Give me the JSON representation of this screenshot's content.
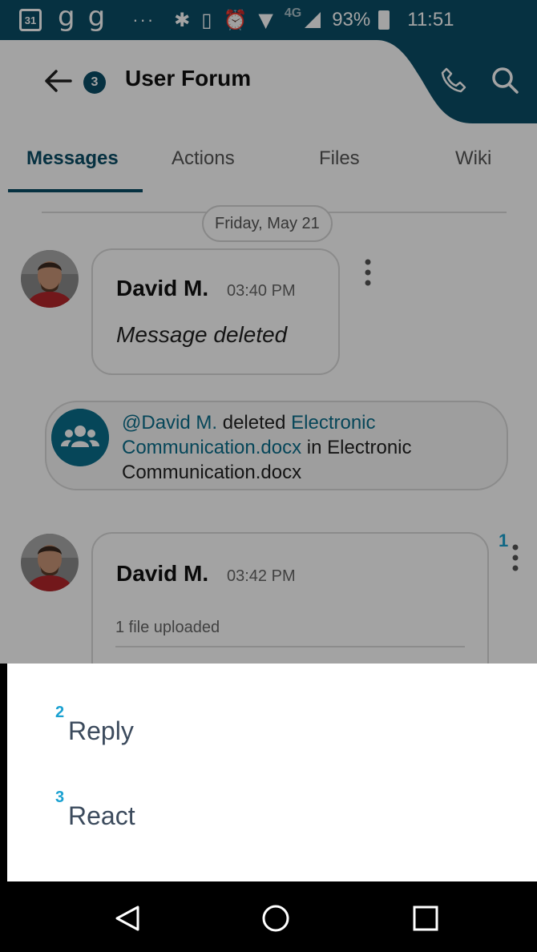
{
  "status_bar": {
    "calendar_day": "31",
    "notification_letters": [
      "g",
      "g"
    ],
    "overflow_dots": "···",
    "network_type": "4G",
    "battery_percent": "93%",
    "time": "11:51"
  },
  "header": {
    "unread_count": "3",
    "title": "User Forum"
  },
  "tabs": [
    {
      "label": "Messages",
      "active": true
    },
    {
      "label": "Actions",
      "active": false
    },
    {
      "label": "Files",
      "active": false
    },
    {
      "label": "Wiki",
      "active": false
    }
  ],
  "feed": {
    "date_divider": "Friday, May 21",
    "messages": [
      {
        "author": "David M.",
        "time": "03:40 PM",
        "body": "Message deleted"
      },
      {
        "author": "David M.",
        "time": "03:42 PM",
        "body": "1 file uploaded",
        "marker": "1"
      }
    ],
    "system_event": {
      "mention": "@David M.",
      "verb": " deleted ",
      "file_link": "Electronic Communication.docx",
      "suffix": " in Electronic Communication.docx"
    }
  },
  "bottom_sheet": {
    "items": [
      {
        "marker": "2",
        "label": "Reply"
      },
      {
        "marker": "3",
        "label": "React"
      }
    ]
  },
  "colors": {
    "brand": "#0a4d66",
    "link": "#0a6e8c",
    "marker": "#1aa1d1"
  }
}
